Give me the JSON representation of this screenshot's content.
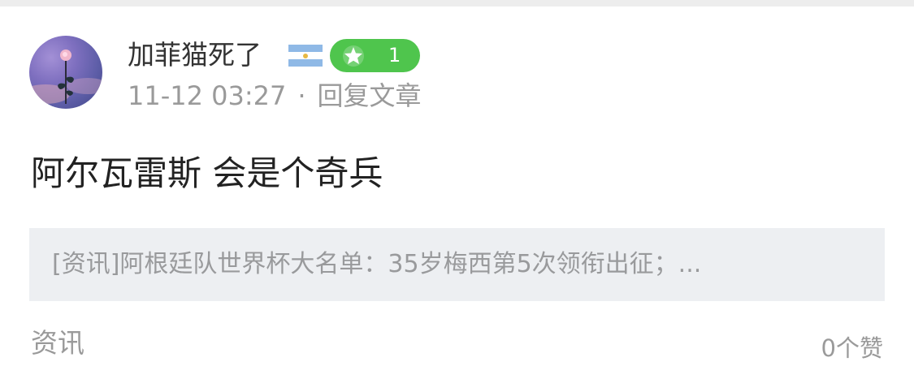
{
  "post": {
    "username": "加菲猫死了",
    "level": "1",
    "timestamp": "11-12 03:27",
    "separator": "·",
    "reply_context": "回复文章",
    "content": "阿尔瓦雷斯 会是个奇兵",
    "quoted_article": "[资讯]阿根廷队世界杯大名单：35岁梅西第5次领衔出征；...",
    "category": "资讯",
    "likes": "0个赞"
  },
  "icons": {
    "avatar": "avatar-flower-photo",
    "flag": "argentina-flag-icon",
    "level_badge": "star-icon"
  },
  "colors": {
    "level_badge": "#4fc54d",
    "secondary_text": "#9a9a9a",
    "quote_background": "#edeff2"
  }
}
